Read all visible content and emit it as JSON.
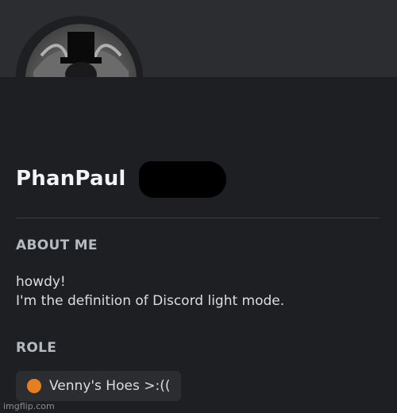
{
  "profile": {
    "username": "PhanPaul",
    "status": "offline",
    "avatar_description": "black top-hat character"
  },
  "about": {
    "label": "ABOUT ME",
    "lines": [
      "howdy!",
      "I'm the definition of Discord light mode."
    ]
  },
  "role": {
    "label": "ROLE",
    "name": "Venny's Hoes >:((",
    "color": "#e67e22"
  },
  "watermark": "imgflip.com"
}
